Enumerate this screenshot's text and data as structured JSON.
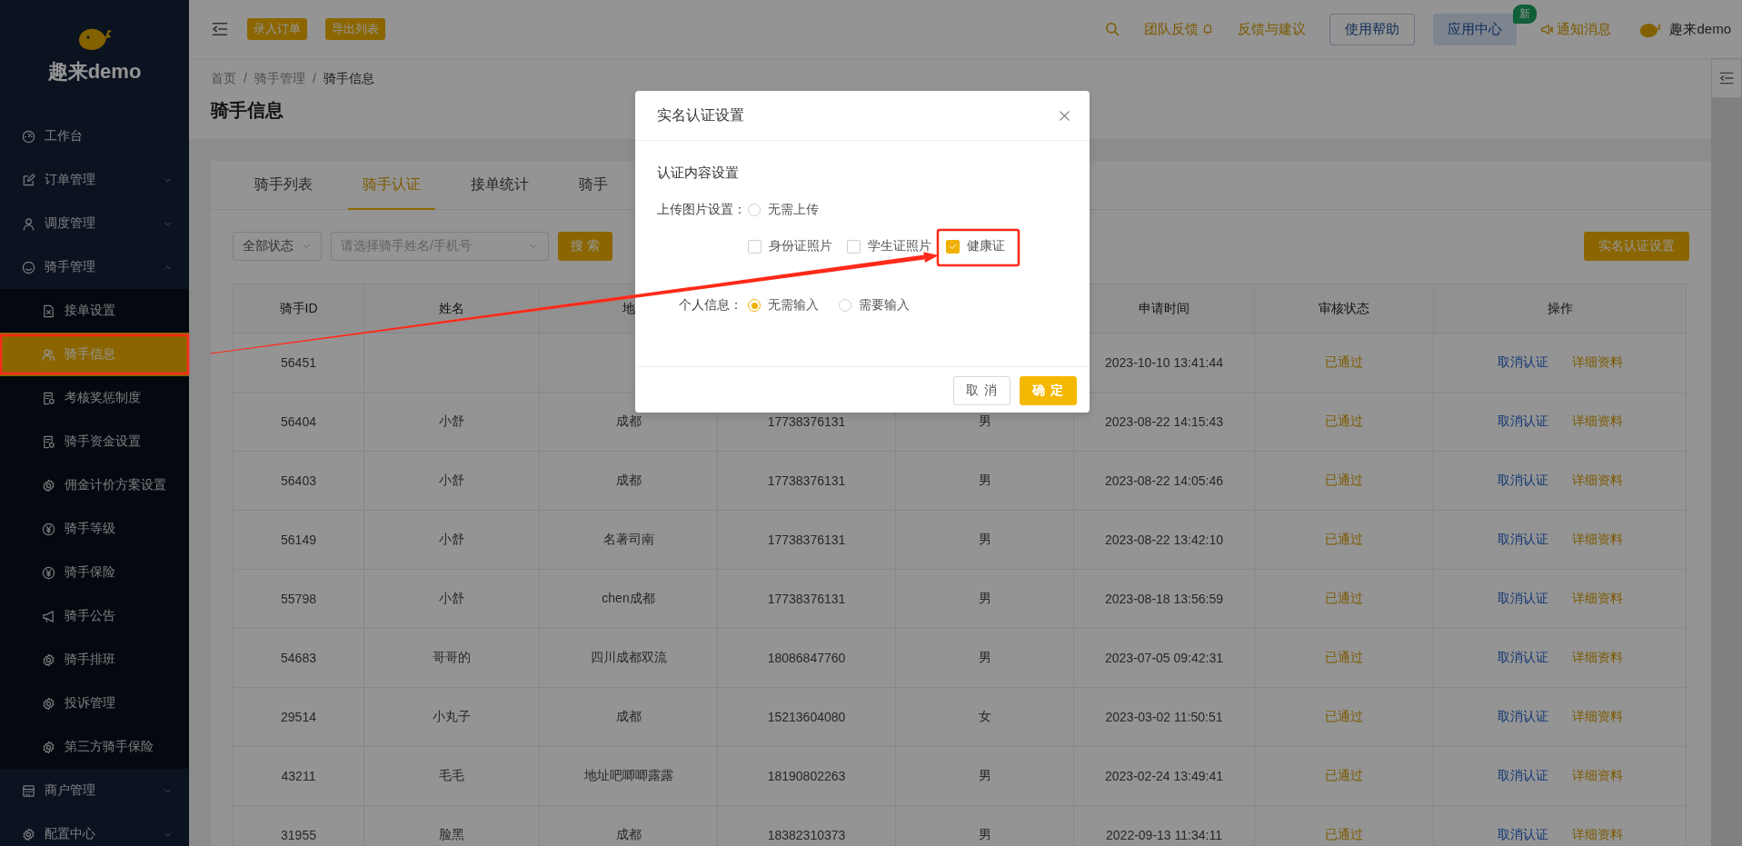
{
  "sidebar": {
    "brand": "趣来demo",
    "items": [
      {
        "label": "工作台",
        "kind": "link"
      },
      {
        "label": "订单管理",
        "kind": "group",
        "expanded": false
      },
      {
        "label": "调度管理",
        "kind": "group",
        "expanded": false
      },
      {
        "label": "骑手管理",
        "kind": "group",
        "expanded": true,
        "children": [
          {
            "label": "接单设置",
            "selected": false
          },
          {
            "label": "骑手信息",
            "selected": true
          },
          {
            "label": "考核奖惩制度",
            "selected": false
          },
          {
            "label": "骑手资金设置",
            "selected": false
          },
          {
            "label": "佣金计价方案设置",
            "selected": false
          },
          {
            "label": "骑手等级",
            "selected": false
          },
          {
            "label": "骑手保险",
            "selected": false
          },
          {
            "label": "骑手公告",
            "selected": false
          },
          {
            "label": "骑手排班",
            "selected": false
          },
          {
            "label": "投诉管理",
            "selected": false
          },
          {
            "label": "第三方骑手保险",
            "selected": false
          }
        ]
      },
      {
        "label": "商户管理",
        "kind": "group",
        "expanded": false
      },
      {
        "label": "配置中心",
        "kind": "group",
        "expanded": false
      }
    ]
  },
  "topbar": {
    "quick_actions": [
      "录入订单",
      "导出列表"
    ],
    "nav": [
      {
        "kind": "bell",
        "label": "团队反馈"
      },
      {
        "kind": "link",
        "label": "反馈与建议"
      },
      {
        "kind": "outline",
        "label": "使用帮助"
      },
      {
        "kind": "filled",
        "label": "应用中心",
        "badge": "新"
      },
      {
        "kind": "notice",
        "label": "通知消息"
      }
    ],
    "user": "趣来demo"
  },
  "breadcrumb": {
    "separator": "/",
    "items": [
      "首页",
      "骑手管理",
      "骑手信息"
    ]
  },
  "page_title": "骑手信息",
  "tabs": [
    {
      "label": "骑手列表",
      "selected": false
    },
    {
      "label": "骑手认证",
      "selected": true
    },
    {
      "label": "接单统计",
      "selected": false
    },
    {
      "label": "骑手",
      "selected": false
    }
  ],
  "filters": {
    "status_select": "全部状态",
    "rider_select_placeholder": "请选择骑手姓名/手机号",
    "search_button": "搜 索",
    "settings_button": "实名认证设置"
  },
  "table": {
    "columns": [
      "骑手ID",
      "姓名",
      "地",
      null,
      null,
      "申请时间",
      "审核状态",
      "操作"
    ],
    "rows": [
      {
        "rider_id": "56451",
        "applied_at": "2023-10-10 13:41:44",
        "status": "已通过",
        "actions": [
          "取消认证",
          "详细资料"
        ]
      },
      {
        "rider_id": "56404",
        "name": "小舒",
        "address": "成都",
        "phone": "17738376131",
        "gender": "男",
        "applied_at": "2023-08-22 14:15:43",
        "status": "已通过",
        "actions": [
          "取消认证",
          "详细资料"
        ]
      },
      {
        "rider_id": "56403",
        "name": "小舒",
        "address": "成都",
        "phone": "17738376131",
        "gender": "男",
        "applied_at": "2023-08-22 14:05:46",
        "status": "已通过",
        "actions": [
          "取消认证",
          "详细资料"
        ]
      },
      {
        "rider_id": "56149",
        "name": "小舒",
        "address": "名著司南",
        "phone": "17738376131",
        "gender": "男",
        "applied_at": "2023-08-22 13:42:10",
        "status": "已通过",
        "actions": [
          "取消认证",
          "详细资料"
        ]
      },
      {
        "rider_id": "55798",
        "name": "小舒",
        "address": "chen成都",
        "phone": "17738376131",
        "gender": "男",
        "applied_at": "2023-08-18 13:56:59",
        "status": "已通过",
        "actions": [
          "取消认证",
          "详细资料"
        ]
      },
      {
        "rider_id": "54683",
        "name": "哥哥的",
        "address": "四川成都双流",
        "phone": "18086847760",
        "gender": "男",
        "applied_at": "2023-07-05 09:42:31",
        "status": "已通过",
        "actions": [
          "取消认证",
          "详细资料"
        ]
      },
      {
        "rider_id": "29514",
        "name": "小丸子",
        "address": "成都",
        "phone": "15213604080",
        "gender": "女",
        "applied_at": "2023-03-02 11:50:51",
        "status": "已通过",
        "actions": [
          "取消认证",
          "详细资料"
        ]
      },
      {
        "rider_id": "43211",
        "name": "毛毛",
        "address": "地址吧唧唧露露",
        "phone": "18190802263",
        "gender": "男",
        "applied_at": "2023-02-24 13:49:41",
        "status": "已通过",
        "actions": [
          "取消认证",
          "详细资料"
        ]
      },
      {
        "rider_id": "31955",
        "name": "脸黑",
        "address": "成都",
        "phone": "18382310373",
        "gender": "男",
        "applied_at": "2022-09-13 11:34:11",
        "status": "已通过",
        "actions": [
          "取消认证",
          "详细资料"
        ]
      }
    ]
  },
  "modal": {
    "title": "实名认证设置",
    "section_title": "认证内容设置",
    "upload": {
      "label": "上传图片设置：",
      "options": [
        {
          "label": "无需上传",
          "selected": false
        }
      ],
      "photos": [
        {
          "label": "身份证照片",
          "checked": false
        },
        {
          "label": "学生证照片",
          "checked": false
        },
        {
          "label": "健康证",
          "checked": true
        }
      ]
    },
    "personal_info": {
      "label": "个人信息：",
      "options": [
        {
          "label": "无需输入",
          "selected": true
        },
        {
          "label": "需要输入",
          "selected": false
        }
      ]
    },
    "buttons": [
      {
        "label": "取 消",
        "kind": "default"
      },
      {
        "label": "确 定",
        "kind": "primary"
      }
    ]
  }
}
